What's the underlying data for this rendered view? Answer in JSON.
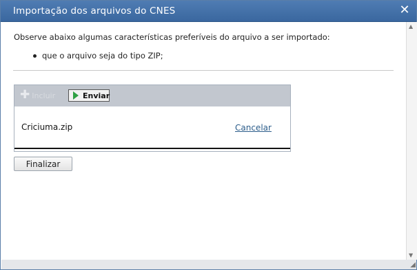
{
  "dialog": {
    "title": "Importação dos arquivos do CNES",
    "close_symbol": "✕"
  },
  "content": {
    "intro": "Observe abaixo algumas características preferíveis do arquivo a ser importado:",
    "bullets": [
      "que o arquivo seja do tipo ZIP;"
    ]
  },
  "upload": {
    "add_label": "Incluir",
    "send_label": "Enviar",
    "file_name": "Criciuma.zip",
    "cancel_label": "Cancelar"
  },
  "actions": {
    "finish_label": "Finalizar"
  },
  "icons": {
    "add": "plus-icon",
    "send": "play-arrow-icon",
    "close": "close-icon"
  },
  "colors": {
    "titlebar": "#3f6ea8",
    "send_arrow": "#2ea043",
    "link": "#2b5c8a"
  }
}
